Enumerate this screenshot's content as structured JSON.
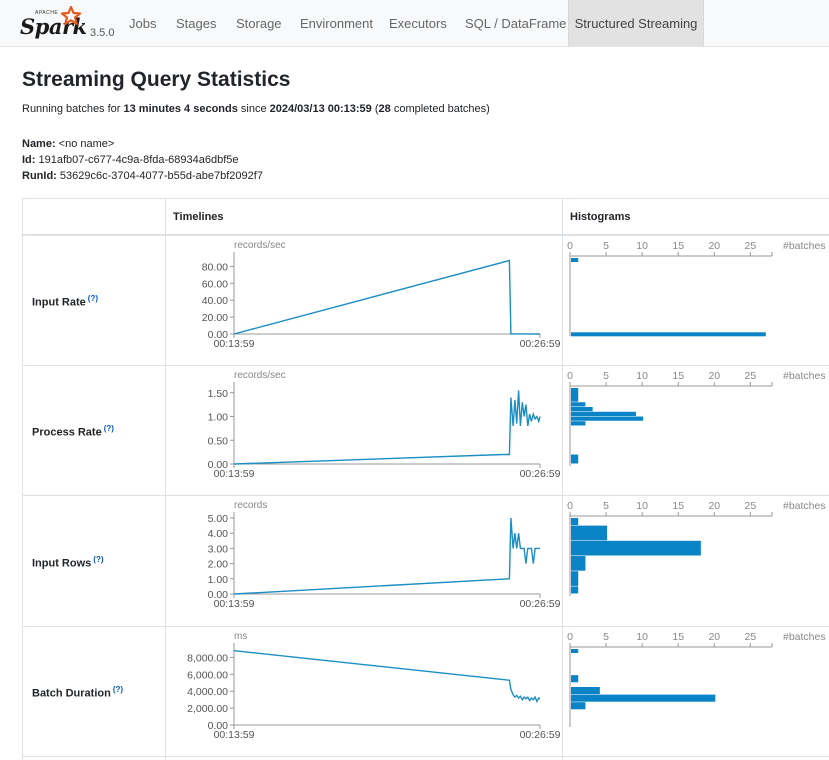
{
  "navbar": {
    "logo_text": "Spark",
    "logo_small": "APACHE",
    "version": "3.5.0",
    "items": [
      {
        "label": "Jobs",
        "active": false
      },
      {
        "label": "Stages",
        "active": false
      },
      {
        "label": "Storage",
        "active": false
      },
      {
        "label": "Environment",
        "active": false
      },
      {
        "label": "Executors",
        "active": false
      },
      {
        "label": "SQL / DataFrame",
        "active": false
      },
      {
        "label": "Structured Streaming",
        "active": true
      }
    ]
  },
  "page": {
    "title": "Streaming Query Statistics",
    "summary": {
      "prefix": "Running batches for ",
      "duration": "13 minutes 4 seconds",
      "since_text": " since ",
      "start_time": "2024/03/13 00:13:59",
      "open_paren": " (",
      "completed_count": "28",
      "suffix": " completed batches)"
    },
    "name_label": "Name:",
    "name_value": " <no name>",
    "id_label": "Id:",
    "id_value": " 191afb07-c677-4c9a-8fda-68934a6dbf5e",
    "runid_label": "RunId:",
    "runid_value": " 53629c6c-3704-4077-b55d-abe7bf2092f7"
  },
  "table": {
    "col_timelines": "Timelines",
    "col_histograms": "Histograms",
    "help_marker": "(?)"
  },
  "colors": {
    "series": "#1b8ec3",
    "hist": "#0a84c6",
    "axis": "#999999"
  },
  "chart_data": [
    {
      "type": "line",
      "title": "Input Rate",
      "ylabel": "records/sec",
      "xticks": [
        "00:13:59",
        "00:26:59"
      ],
      "yticks": [
        "0.00",
        "20.00",
        "40.00",
        "60.00",
        "80.00"
      ],
      "ylim": [
        0,
        90
      ],
      "x": [
        0,
        0.9,
        0.905,
        0.93,
        0.96,
        1.0
      ],
      "y": [
        0,
        87,
        0.1,
        0.1,
        0.1,
        0
      ]
    },
    {
      "type": "bar",
      "title": "Input Rate histogram",
      "xlabel": "#batches",
      "xticks": [
        "0",
        "5",
        "10",
        "15",
        "20",
        "25"
      ],
      "xlim": [
        0,
        28
      ],
      "ylim": [
        0,
        90
      ],
      "bins": [
        {
          "from": 85,
          "to": 90,
          "count": 1
        },
        {
          "from": 0,
          "to": 2,
          "count": 27
        }
      ]
    },
    {
      "type": "line",
      "title": "Process Rate",
      "ylabel": "records/sec",
      "xticks": [
        "00:13:59",
        "00:26:59"
      ],
      "yticks": [
        "0.00",
        "0.50",
        "1.00",
        "1.50"
      ],
      "ylim": [
        0,
        1.6
      ],
      "x": [
        0,
        0.88,
        0.9,
        0.905,
        0.912,
        0.918,
        0.924,
        0.93,
        0.936,
        0.942,
        0.948,
        0.954,
        0.96,
        0.966,
        0.972,
        0.978,
        0.984,
        0.99,
        0.996,
        1.0
      ],
      "y": [
        0,
        0.2,
        0.2,
        1.4,
        0.8,
        1.35,
        0.85,
        1.55,
        0.8,
        1.3,
        1.0,
        1.25,
        0.8,
        1.05,
        0.9,
        1.05,
        0.95,
        1.0,
        0.9,
        1.0
      ]
    },
    {
      "type": "bar",
      "title": "Process Rate histogram",
      "xlabel": "#batches",
      "xticks": [
        "0",
        "5",
        "10",
        "15",
        "20",
        "25"
      ],
      "xlim": [
        0,
        28
      ],
      "ylim": [
        0,
        1.6
      ],
      "bins": [
        {
          "from": 0,
          "to": 0.2,
          "count": 1
        },
        {
          "from": 0.8,
          "to": 0.9,
          "count": 2
        },
        {
          "from": 0.9,
          "to": 1.0,
          "count": 10
        },
        {
          "from": 1.0,
          "to": 1.1,
          "count": 9
        },
        {
          "from": 1.1,
          "to": 1.2,
          "count": 3
        },
        {
          "from": 1.2,
          "to": 1.3,
          "count": 2
        },
        {
          "from": 1.3,
          "to": 1.6,
          "count": 1
        }
      ]
    },
    {
      "type": "line",
      "title": "Input Rows",
      "ylabel": "records",
      "xticks": [
        "00:13:59",
        "00:26:59"
      ],
      "yticks": [
        "0.00",
        "1.00",
        "2.00",
        "3.00",
        "4.00",
        "5.00"
      ],
      "ylim": [
        0,
        5
      ],
      "x": [
        0,
        0.9,
        0.905,
        0.912,
        0.918,
        0.924,
        0.93,
        0.936,
        0.942,
        0.948,
        0.954,
        0.96,
        0.966,
        0.972,
        0.978,
        0.984,
        0.99,
        0.996,
        1.0
      ],
      "y": [
        0,
        1,
        5,
        3,
        4,
        3,
        4,
        3,
        3,
        3,
        2,
        3,
        3,
        3,
        2,
        3,
        3,
        3,
        3
      ]
    },
    {
      "type": "bar",
      "title": "Input Rows histogram",
      "xlabel": "#batches",
      "xticks": [
        "0",
        "5",
        "10",
        "15",
        "20",
        "25"
      ],
      "xlim": [
        0,
        28
      ],
      "ylim": [
        0,
        5
      ],
      "bins": [
        {
          "from": 0,
          "to": 0.5,
          "count": 1
        },
        {
          "from": 0.5,
          "to": 1.5,
          "count": 1
        },
        {
          "from": 1.5,
          "to": 2.5,
          "count": 2
        },
        {
          "from": 2.5,
          "to": 3.5,
          "count": 18
        },
        {
          "from": 3.5,
          "to": 4.5,
          "count": 5
        },
        {
          "from": 4.5,
          "to": 5.0,
          "count": 1
        }
      ]
    },
    {
      "type": "line",
      "title": "Batch Duration",
      "ylabel": "ms",
      "xticks": [
        "00:13:59",
        "00:26:59"
      ],
      "yticks": [
        "0.00",
        "2,000.00",
        "4,000.00",
        "6,000.00",
        "8,000.00"
      ],
      "ylim": [
        0,
        9000
      ],
      "x": [
        0,
        0.9,
        0.905,
        0.912,
        0.918,
        0.924,
        0.93,
        0.936,
        0.942,
        0.948,
        0.954,
        0.96,
        0.966,
        0.972,
        0.978,
        0.984,
        0.99,
        0.996,
        1.0
      ],
      "y": [
        8800,
        5300,
        4200,
        3600,
        3300,
        3500,
        3200,
        3400,
        3000,
        3300,
        3100,
        3300,
        2900,
        3200,
        3000,
        3300,
        2800,
        3200,
        3100
      ]
    },
    {
      "type": "bar",
      "title": "Batch Duration histogram",
      "xlabel": "#batches",
      "xticks": [
        "0",
        "5",
        "10",
        "15",
        "20",
        "25"
      ],
      "xlim": [
        0,
        28
      ],
      "ylim": [
        0,
        9000
      ],
      "bins": [
        {
          "from": 1800,
          "to": 2700,
          "count": 2
        },
        {
          "from": 2700,
          "to": 3600,
          "count": 20
        },
        {
          "from": 3600,
          "to": 4500,
          "count": 4
        },
        {
          "from": 5000,
          "to": 5900,
          "count": 1
        },
        {
          "from": 8500,
          "to": 9000,
          "count": 1
        }
      ]
    }
  ]
}
